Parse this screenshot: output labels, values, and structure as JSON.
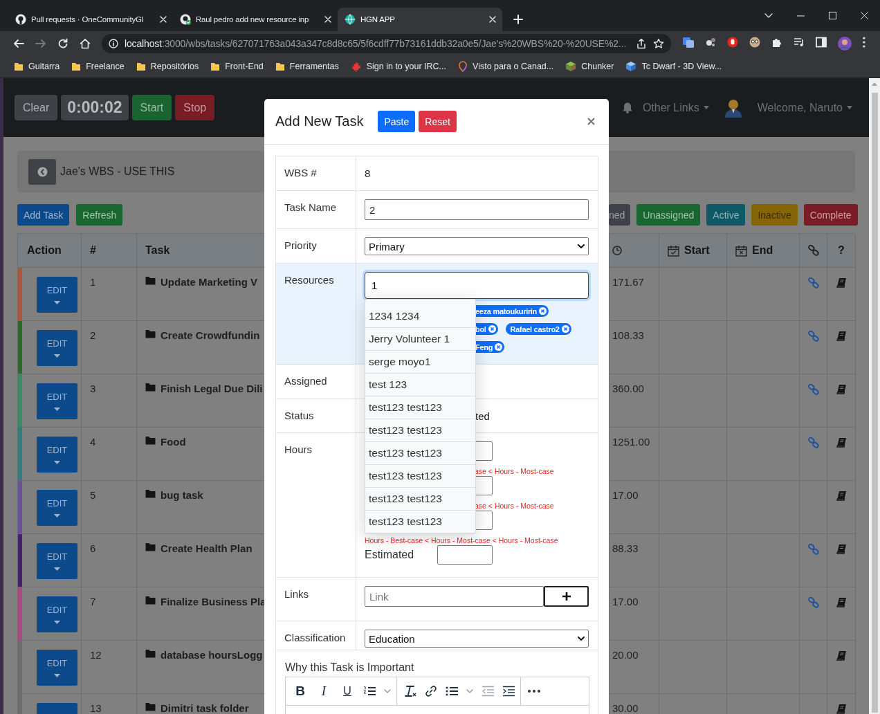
{
  "browser": {
    "tabs": [
      {
        "title": "Pull requests · OneCommunityGl",
        "kind": "plain",
        "selected": false
      },
      {
        "title": "Raul pedro add new resource inp",
        "kind": "checked",
        "selected": false
      },
      {
        "title": "HGN APP",
        "kind": "app",
        "selected": true
      }
    ],
    "address": {
      "host": "localhost",
      "path": ":3000/wbs/tasks/627071763a043a347c8d8c65/5f6cdff77b73161ddb32a0e5/Jae's%20WBS%20-%20USE%2..."
    },
    "bookmarks": [
      {
        "label": "Guitarra",
        "kind": "folder"
      },
      {
        "label": "Freelance",
        "kind": "folder"
      },
      {
        "label": "Repositórios",
        "kind": "folder"
      },
      {
        "label": "Front-End",
        "kind": "folder"
      },
      {
        "label": "Ferramentas",
        "kind": "folder"
      },
      {
        "label": "Sign in to your IRC...",
        "kind": "leaf"
      },
      {
        "label": "Visto para o Canad...",
        "kind": "pin"
      },
      {
        "label": "Chunker",
        "kind": "block"
      },
      {
        "label": "Tc Dwarf - 3D View...",
        "kind": "cube"
      }
    ]
  },
  "navbar": {
    "buttons": [
      {
        "label": "Clear",
        "kind": "clear"
      },
      {
        "label": "0:00:02",
        "kind": "timer"
      },
      {
        "label": "Start",
        "kind": "start"
      },
      {
        "label": "Stop",
        "kind": "stop"
      }
    ],
    "other_links": "Other Links",
    "welcome": "Welcome, Naruto"
  },
  "wbs": {
    "title": "Jae's WBS - USE THIS"
  },
  "actions": [
    {
      "label": "Add Task",
      "kind": "primary"
    },
    {
      "label": "Refresh",
      "kind": "success"
    }
  ],
  "filters": [
    {
      "label": "ned",
      "kind": "secondary"
    },
    {
      "label": "Unassigned",
      "kind": "success"
    },
    {
      "label": "Active",
      "kind": "info"
    },
    {
      "label": "Inactive",
      "kind": "warning"
    },
    {
      "label": "Complete",
      "kind": "danger"
    }
  ],
  "table": {
    "columns": [
      {
        "label": "Action",
        "kind": "plain"
      },
      {
        "label": "#",
        "kind": "plain"
      },
      {
        "label": "Task",
        "kind": "plain"
      },
      {
        "kind": "clock"
      },
      {
        "label": "Start",
        "kind": "start"
      },
      {
        "label": "End",
        "kind": "end"
      },
      {
        "kind": "links"
      },
      {
        "label": "?",
        "kind": "plain"
      }
    ],
    "rows": [
      {
        "edit": "EDIT",
        "number": "1",
        "task": "Update Marketing V",
        "hours": "171.67",
        "has_link": true,
        "color": "#a8593a"
      },
      {
        "edit": "EDIT",
        "number": "2",
        "task": "Create Crowdfundin",
        "hours": "108.33",
        "has_link": true,
        "color": "#2a6b2c"
      },
      {
        "edit": "EDIT",
        "number": "3",
        "task": "Finish Legal Due Dili",
        "hours": "360.00",
        "has_link": true,
        "color": "#3a8a66"
      },
      {
        "edit": "EDIT",
        "number": "4",
        "task": "Food",
        "hours": "1251.00",
        "has_link": true,
        "color": "#2f7f80"
      },
      {
        "edit": "EDIT",
        "number": "5",
        "task": "bug task",
        "hours": "17.00",
        "has_link": false,
        "color": "#6a4f9e"
      },
      {
        "edit": "EDIT",
        "number": "6",
        "task": "Create Health Plan",
        "hours": "88.33",
        "has_link": true,
        "color": "#46206e"
      },
      {
        "edit": "EDIT",
        "number": "7",
        "task": "Finalize Business Pla",
        "hours": "17.00",
        "has_link": true,
        "color": "#a84a86"
      },
      {
        "edit": "EDIT",
        "number": "12",
        "task": "database hoursLogg",
        "hours": "20.00",
        "has_link": false,
        "color": "#6c6c6c"
      },
      {
        "number": "13",
        "task": "Dimitri task folder",
        "hours": "30.00",
        "has_link": false,
        "color": "#6c6c6c"
      }
    ]
  },
  "modal": {
    "title": "Add New Task",
    "buttons": [
      {
        "label": "Paste",
        "kind": "primary"
      },
      {
        "label": "Reset",
        "kind": "danger"
      }
    ],
    "rows": [
      {
        "label": "WBS #",
        "kind": "text",
        "value": "8"
      },
      {
        "label": "Task Name",
        "kind": "input",
        "value": "2"
      },
      {
        "label": "Priority",
        "kind": "select",
        "value": "Primary"
      },
      {
        "label": "Resources",
        "kind": "resources",
        "value": "1",
        "chip_rows": [
          [
            {
              "name": "eeza matoukuririn",
              "clipped": true
            }
          ],
          [
            {
              "name": "bol",
              "clipped": true
            },
            {
              "name": "Rafael castro2",
              "clipped": false
            }
          ],
          [
            {
              "name": "Feng",
              "clipped": true
            }
          ]
        ],
        "suggestions": [
          "1234 1234",
          "Jerry Volunteer 1",
          "serge moyo1",
          "test 123",
          "test123 test123",
          "test123 test123",
          "test123 test123",
          "test123 test123",
          "test123 test123",
          "test123 test123"
        ]
      },
      {
        "label": "Assigned",
        "kind": "blank"
      },
      {
        "label": "Status",
        "kind": "partial",
        "value": "ted"
      },
      {
        "label": "Hours",
        "kind": "hours",
        "fields": [
          {
            "error": "ase < Hours - Most-case",
            "clipped": true
          },
          {
            "error": "ase < Hours - Most-case",
            "clipped": true
          },
          {
            "error": "Hours - Best-case < Hours - Most-case < Hours - Most-case",
            "clipped": false
          },
          {
            "label": "Estimated"
          }
        ]
      },
      {
        "label": "Links",
        "kind": "links",
        "placeholder": "Link"
      },
      {
        "label": "Classification",
        "kind": "select",
        "value": "Education"
      },
      {
        "label": "Why this Task is Important",
        "kind": "editor",
        "format_buttons": [
          "B",
          "I",
          "U"
        ],
        "outdent_disabled": true
      }
    ]
  }
}
